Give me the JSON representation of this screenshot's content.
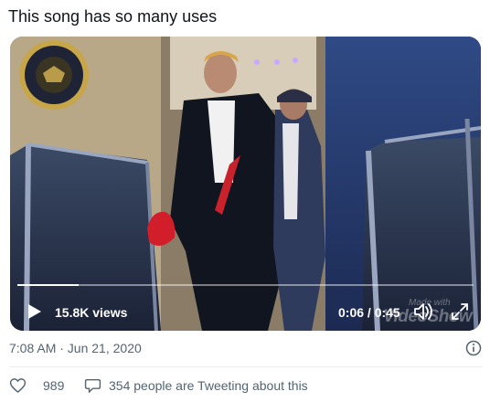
{
  "tweet": {
    "text": "This song has so many uses",
    "timestamp": "7:08 AM · Jun 21, 2020"
  },
  "video": {
    "views": "15.8K views",
    "time": "0:06 / 0:45",
    "progress": 0.1333,
    "watermark_main": "VideoShow",
    "watermark_small": "Made with"
  },
  "actions": {
    "like_count": "989",
    "discussion": "354 people are Tweeting about this"
  },
  "icons": {
    "play": "play-icon",
    "volume": "volume-icon",
    "fullscreen": "fullscreen-icon",
    "info": "info-icon",
    "like": "heart-icon",
    "discussion": "speech-bubble-icon"
  },
  "colors": {
    "text_primary": "#0f1419",
    "text_secondary": "#536471",
    "divider": "#e6ecf0"
  }
}
